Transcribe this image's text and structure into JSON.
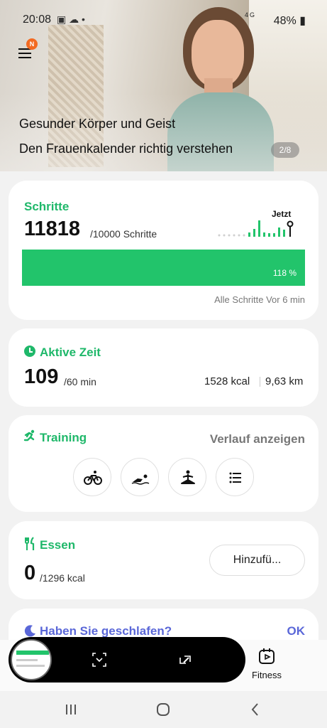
{
  "status_bar": {
    "time": "20:08",
    "network": "4G",
    "battery": "48%"
  },
  "menu": {
    "badge": "N"
  },
  "banner": {
    "line1": "Gesunder Körper und Geist",
    "line2": "Den Frauenkalender richtig verstehen",
    "pager": "2/8"
  },
  "steps": {
    "title": "Schritte",
    "value": "11818",
    "goal": "/10000 Schritte",
    "now_label": "Jetzt",
    "progress_fraction": 1.18,
    "progress_label": "118 %",
    "footer": "Alle Schritte Vor 6 min"
  },
  "active_time": {
    "title": "Aktive Zeit",
    "value": "109",
    "goal": "/60 min",
    "kcal": "1528 kcal",
    "distance": "9,63 km"
  },
  "training": {
    "title": "Training",
    "history_link": "Verlauf anzeigen",
    "icons": [
      "cycling-icon",
      "swimming-icon",
      "yoga-icon",
      "list-icon"
    ]
  },
  "food": {
    "title": "Essen",
    "value": "0",
    "goal": "/1296 kcal",
    "add_button": "Hinzufü..."
  },
  "sleep": {
    "title": "Haben Sie geschlafen?",
    "ok": "OK"
  },
  "bottom_nav": {
    "fitness_label": "Fitness"
  },
  "colors": {
    "accent": "#1fb86a",
    "progress": "#22c46b",
    "sleep": "#5a67d8",
    "badge": "#f36a21"
  }
}
